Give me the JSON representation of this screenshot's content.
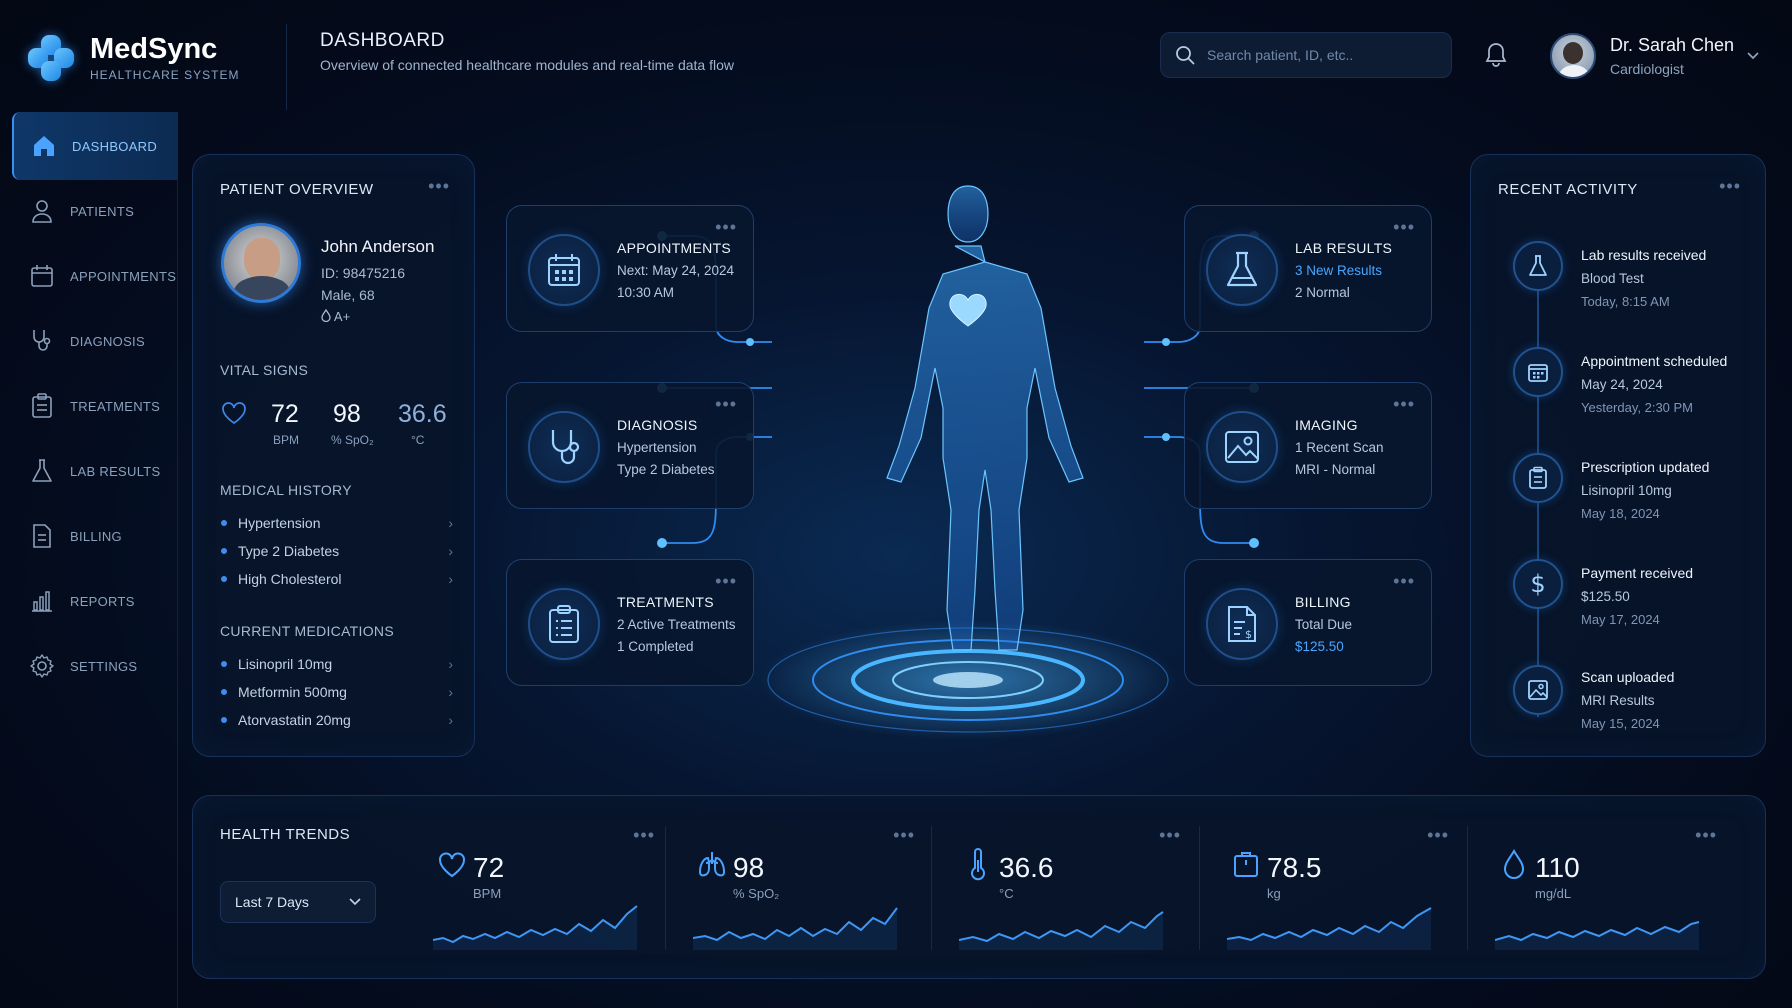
{
  "brand": {
    "name": "MedSync",
    "subtitle": "HEALTHCARE SYSTEM"
  },
  "header": {
    "title": "DASHBOARD",
    "subtitle": "Overview of connected healthcare modules and real-time data flow",
    "search_placeholder": "Search patient, ID, etc..",
    "user_name": "Dr. Sarah Chen",
    "user_role": "Cardiologist"
  },
  "sidebar": {
    "items": [
      {
        "label": "DASHBOARD",
        "icon": "home-icon",
        "active": true
      },
      {
        "label": "PATIENTS",
        "icon": "user-icon"
      },
      {
        "label": "APPOINTMENTS",
        "icon": "calendar-icon"
      },
      {
        "label": "DIAGNOSIS",
        "icon": "stethoscope-icon"
      },
      {
        "label": "TREATMENTS",
        "icon": "clipboard-icon"
      },
      {
        "label": "LAB RESULTS",
        "icon": "flask-icon"
      },
      {
        "label": "BILLING",
        "icon": "document-icon"
      },
      {
        "label": "REPORTS",
        "icon": "bar-chart-icon"
      },
      {
        "label": "SETTINGS",
        "icon": "gear-icon"
      }
    ]
  },
  "patient": {
    "title": "PATIENT OVERVIEW",
    "name": "John Anderson",
    "id": "ID: 98475216",
    "sex_age": "Male, 68",
    "blood": "A+",
    "vitals_title": "VITAL SIGNS",
    "vitals": [
      {
        "value": "72",
        "unit": "BPM"
      },
      {
        "value": "98",
        "unit": "% SpO₂"
      },
      {
        "value": "36.6",
        "unit": "°C"
      }
    ],
    "history_title": "MEDICAL HISTORY",
    "history": [
      "Hypertension",
      "Type 2 Diabetes",
      "High Cholesterol"
    ],
    "meds_title": "CURRENT MEDICATIONS",
    "meds": [
      "Lisinopril 10mg",
      "Metformin 500mg",
      "Atorvastatin 20mg"
    ]
  },
  "modules": {
    "appointments": {
      "title": "APPOINTMENTS",
      "l1": "Next: May 24, 2024",
      "l2": "10:30 AM"
    },
    "diagnosis": {
      "title": "DIAGNOSIS",
      "l1": "Hypertension",
      "l2": "Type 2 Diabetes"
    },
    "treatments": {
      "title": "TREATMENTS",
      "l1": "2 Active Treatments",
      "l2": "1 Completed"
    },
    "lab": {
      "title": "LAB RESULTS",
      "l1": "3 New Results",
      "l2": "2 Normal"
    },
    "imaging": {
      "title": "IMAGING",
      "l1": "1 Recent Scan",
      "l2": "MRI - Normal"
    },
    "billing": {
      "title": "BILLING",
      "l1": "Total Due",
      "l2": "$125.50"
    }
  },
  "activity": {
    "title": "RECENT ACTIVITY",
    "items": [
      {
        "title": "Lab results received",
        "detail": "Blood Test",
        "time": "Today, 8:15 AM",
        "icon": "flask-icon"
      },
      {
        "title": "Appointment scheduled",
        "detail": "May 24, 2024",
        "time": "Yesterday, 2:30 PM",
        "icon": "calendar-icon"
      },
      {
        "title": "Prescription updated",
        "detail": "Lisinopril 10mg",
        "time": "May 18, 2024",
        "icon": "clipboard-icon"
      },
      {
        "title": "Payment received",
        "detail": "$125.50",
        "time": "May 17, 2024",
        "icon": "dollar-icon"
      },
      {
        "title": "Scan uploaded",
        "detail": "MRI Results",
        "time": "May 15, 2024",
        "icon": "image-icon"
      }
    ]
  },
  "trends": {
    "title": "HEALTH TRENDS",
    "range": "Last 7 Days",
    "metrics": [
      {
        "value": "72",
        "unit": "BPM",
        "icon": "heart-icon"
      },
      {
        "value": "98",
        "unit": "% SpO₂",
        "icon": "lungs-icon"
      },
      {
        "value": "36.6",
        "unit": "°C",
        "icon": "thermometer-icon"
      },
      {
        "value": "78.5",
        "unit": "kg",
        "icon": "scale-icon"
      },
      {
        "value": "110",
        "unit": "mg/dL",
        "icon": "drop-icon"
      }
    ]
  },
  "colors": {
    "accent": "#3a8ff0",
    "highlight": "#48a6ff",
    "background": "#040b1c"
  }
}
